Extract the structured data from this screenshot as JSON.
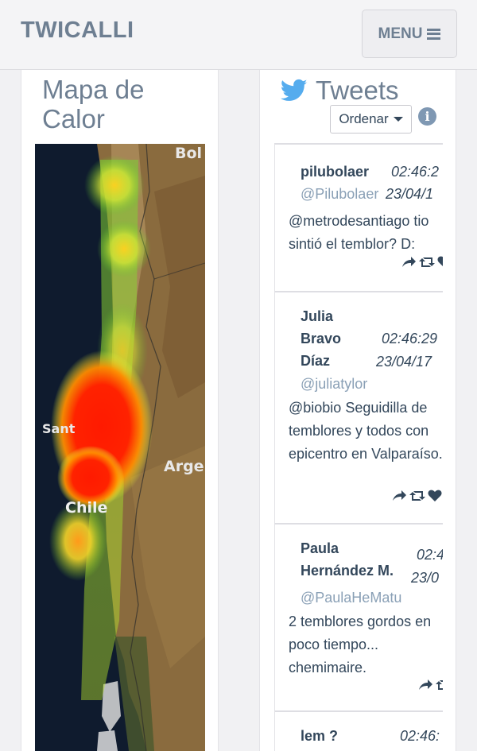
{
  "navbar": {
    "brand": "TWICALLI",
    "menu_label": "MENU"
  },
  "heatmap": {
    "title_line1": "Mapa de",
    "title_line2": "Calor",
    "map_labels": {
      "bolivia": "Bol",
      "santiago": "Sant",
      "argentina": "Arge",
      "chile": "Chile"
    }
  },
  "tweets_panel": {
    "title": "Tweets",
    "sort_label": "Ordenar",
    "info_icon": "i",
    "items": [
      {
        "name_lines": [
          "pilubolaer"
        ],
        "time": "02:46:2",
        "handle": "@Pilubolaer",
        "date": "23/04/1",
        "text": "@metrodesantiago tio sintió el temblor? D:"
      },
      {
        "name_lines": [
          "Julia",
          "Bravo",
          "Díaz"
        ],
        "time": "02:46:29",
        "handle": "@juliatylor",
        "date": "23/04/17",
        "text": "@biobio Seguidilla de temblores y todos con epicentro en Valparaíso."
      },
      {
        "name_lines": [
          "Paula",
          "Hernández M."
        ],
        "time": "02:4",
        "handle": "@PaulaHeMatu",
        "date": "23/0",
        "text": "2 temblores gordos en poco tiempo... chemimaire."
      },
      {
        "name_lines": [
          "lem ?"
        ],
        "time": "02:46:",
        "handle": "",
        "date": "",
        "text": ""
      }
    ]
  },
  "colors": {
    "brand": "#6e7f92",
    "text": "#33475b",
    "handle": "#8aa0b6",
    "twitter_blue": "#55acee",
    "info": "#7f98b3"
  }
}
